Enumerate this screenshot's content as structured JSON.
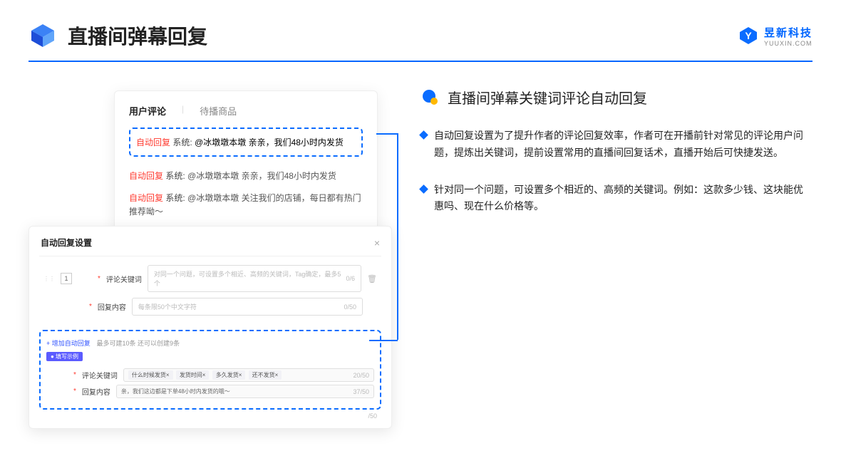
{
  "header": {
    "title": "直播间弹幕回复",
    "logo_cn": "昱新科技",
    "logo_en": "YUUXIN.COM"
  },
  "cardA": {
    "tab_active": "用户评论",
    "tab_inactive": "待播商品",
    "highlighted_msg_prefix": "自动回复",
    "highlighted_msg_sys": "系统:",
    "highlighted_msg_body": "@冰墩墩本墩 亲亲，我们48小时内发货",
    "msg2_prefix": "自动回复",
    "msg2_sys": "系统:",
    "msg2_body": "@冰墩墩本墩 亲亲，我们48小时内发货",
    "msg3_prefix": "自动回复",
    "msg3_sys": "系统:",
    "msg3_body": "@冰墩墩本墩 关注我们的店铺，每日都有热门推荐呦～"
  },
  "cardB": {
    "modal_title": "自动回复设置",
    "row_index": "1",
    "label_keyword": "评论关键词",
    "placeholder_keyword": "对同一个问题，可设置多个相近、高频的关键词，Tag确定，最多5个",
    "count_keyword": "0/6",
    "label_content": "回复内容",
    "placeholder_content": "每条限50个中文字符",
    "count_content": "0/50",
    "add_link": "+ 增加自动回复",
    "add_note": "最多可建10条 还可以创建9条",
    "example_badge": "● 填写示例",
    "ex_label_keyword": "评论关键词",
    "ex_tags": [
      "什么时候发货×",
      "发货时间×",
      "多久发货×",
      "还不发货×"
    ],
    "ex_count1": "20/50",
    "ex_label_content": "回复内容",
    "ex_content_text": "亲，我们这边都是下单48小时内发货的哦～",
    "ex_count2": "37/50",
    "trailing_count": "/50"
  },
  "right": {
    "subtitle": "直播间弹幕关键词评论自动回复",
    "bullet1": "自动回复设置为了提升作者的评论回复效率，作者可在开播前针对常见的评论用户问题，提炼出关键词，提前设置常用的直播间回复话术，直播开始后可快捷发送。",
    "bullet2": "针对同一个问题，可设置多个相近的、高频的关键词。例如：这款多少钱、这块能优惠吗、现在什么价格等。"
  }
}
